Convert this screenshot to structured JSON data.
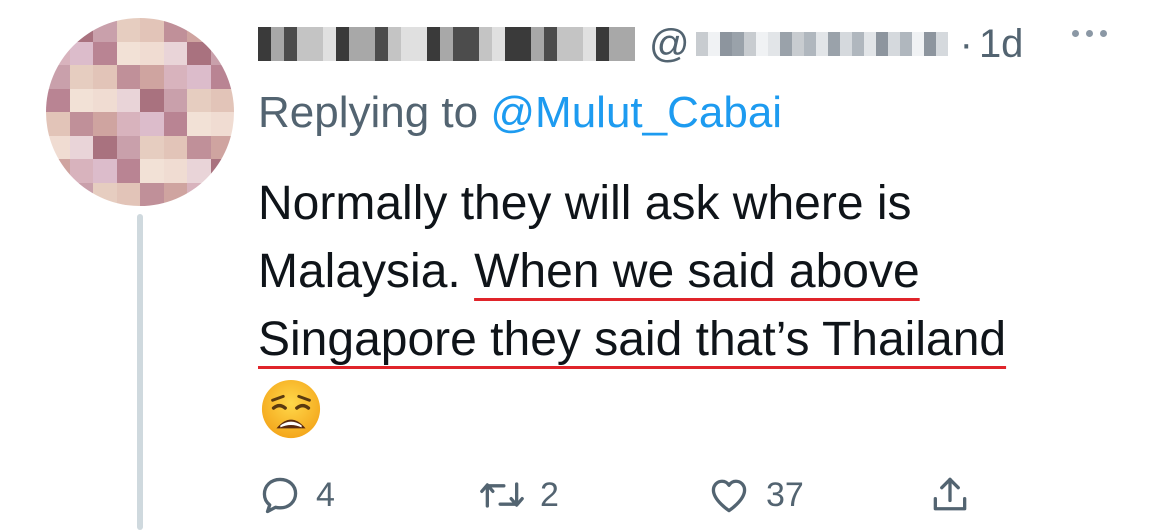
{
  "tweet": {
    "handle_prefix": "@",
    "separator": "·",
    "timestamp": "1d",
    "reply_prefix": "Replying to",
    "reply_mention": "@Mulut_Cabai",
    "body": {
      "line1": "Normally they will ask where is",
      "line2_plain": "Malaysia. ",
      "line2_highlight": "When we said above",
      "line3_highlight": "Singapore they said that’s Thailand",
      "emoji": "weary-face-emoji"
    },
    "actions": {
      "reply_count": "4",
      "retweet_count": "2",
      "like_count": "37"
    }
  },
  "colors": {
    "text": "#0f1419",
    "secondary": "#536471",
    "link": "#1d9bf0",
    "highlight_underline": "#e0242a",
    "thread_line": "#cfd9de"
  }
}
